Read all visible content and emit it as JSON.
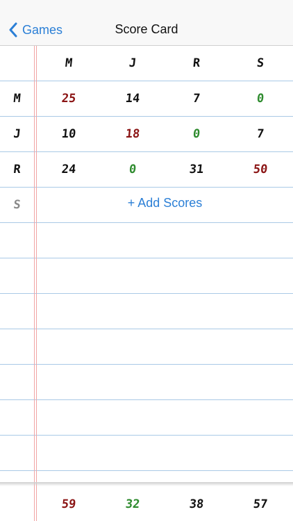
{
  "nav": {
    "back_label": "Games",
    "title": "Score Card"
  },
  "players": [
    "M",
    "J",
    "R",
    "S"
  ],
  "rows": [
    {
      "player": "M",
      "scores": [
        "25",
        "14",
        "7",
        "0"
      ]
    },
    {
      "player": "J",
      "scores": [
        "10",
        "18",
        "0",
        "7"
      ]
    },
    {
      "player": "R",
      "scores": [
        "24",
        "0",
        "31",
        "50"
      ]
    }
  ],
  "pending_row": {
    "player": "S",
    "action_label": "+ Add Scores"
  },
  "totals": [
    "59",
    "32",
    "38",
    "57"
  ],
  "colors": {
    "accent": "#2b7fd6",
    "red": "#8b1414",
    "green": "#2e8b2e",
    "ruled_line": "#a9c9e6",
    "margin_line": "#f1a5a5"
  }
}
